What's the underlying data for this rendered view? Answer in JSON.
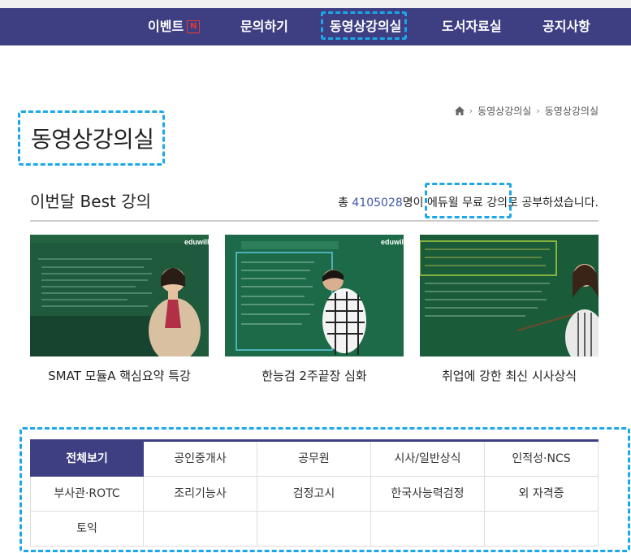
{
  "nav": {
    "items": [
      {
        "label": "이벤트",
        "badge": "N"
      },
      {
        "label": "문의하기"
      },
      {
        "label": "동영상강의실"
      },
      {
        "label": "도서자료실"
      },
      {
        "label": "공지사항"
      }
    ]
  },
  "breadcrumb": [
    "동영상강의실",
    "동영상강의실"
  ],
  "page_title": "동영상강의실",
  "best": {
    "heading": "이번달 Best 강의",
    "stat_prefix": "총 ",
    "stat_count": "4105028",
    "stat_suffix": "명이 에듀윌 무료 강의로 공부하셨습니다."
  },
  "videos": [
    {
      "title": "SMAT 모듈A 핵심요약 특강",
      "brand": "eduwill"
    },
    {
      "title": "한능검 2주끝장 심화",
      "brand": "eduwill"
    },
    {
      "title": "취업에 강한 최신 시사상식"
    }
  ],
  "categories": [
    "전체보기",
    "공인중개사",
    "공무원",
    "시사/일반상식",
    "인적성·NCS",
    "부사관·ROTC",
    "조리기능사",
    "검정고시",
    "한국사능력검정",
    "외 자격증",
    "토익",
    "",
    "",
    "",
    ""
  ],
  "colors": {
    "nav_bg": "#3d3f82",
    "accent_number": "#3d59a8",
    "highlight_dash": "#1ea7e8",
    "chalkboard": "#1e5e3e"
  }
}
